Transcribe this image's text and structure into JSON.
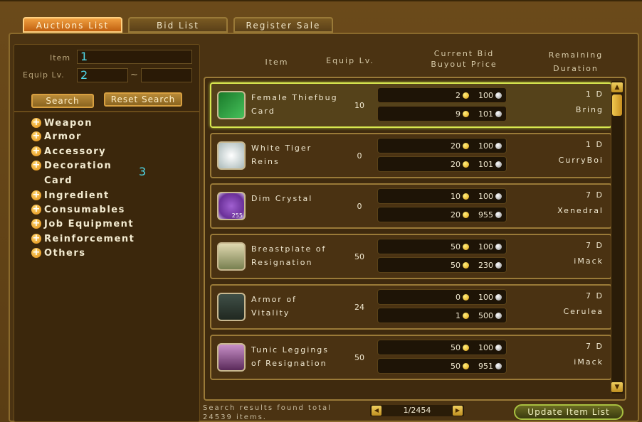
{
  "tabs": [
    {
      "label": "Auctions List",
      "active": true
    },
    {
      "label": "Bid List",
      "active": false
    },
    {
      "label": "Register Sale",
      "active": false
    }
  ],
  "search": {
    "item_label": "Item",
    "item_value": "1",
    "equip_label": "Equip Lv.",
    "equip_min": "2",
    "equip_sep": "~",
    "equip_max": "",
    "search_button": "Search",
    "reset_button": "Reset Search"
  },
  "categories": [
    {
      "label": "Weapon",
      "plus": "+"
    },
    {
      "label": "Armor",
      "plus": "+"
    },
    {
      "label": "Accessory",
      "plus": "+"
    },
    {
      "label": "Decoration",
      "plus": "+"
    },
    {
      "label": "Card"
    },
    {
      "label": "Ingredient",
      "plus": "+"
    },
    {
      "label": "Consumables",
      "plus": "+"
    },
    {
      "label": "Job Equipment",
      "plus": "+"
    },
    {
      "label": "Reinforcement",
      "plus": "+"
    },
    {
      "label": "Others",
      "plus": "+"
    }
  ],
  "category_marker": "3",
  "headers": {
    "item": "Item",
    "equip_lv": "Equip Lv.",
    "current_bid": "Current Bid",
    "buyout": "Buyout Price",
    "remaining": "Remaining",
    "duration": "Duration"
  },
  "items": [
    {
      "name_1": "Female Thiefbug",
      "name_2": "Card",
      "level": "10",
      "bid_gold": "2",
      "bid_silver": "100",
      "buy_gold": "9",
      "buy_silver": "101",
      "duration": "1 D",
      "seller": "Bring",
      "icon": "card-icon",
      "selected": true
    },
    {
      "name_1": "White Tiger",
      "name_2": "Reins",
      "level": "0",
      "bid_gold": "20",
      "bid_silver": "100",
      "buy_gold": "20",
      "buy_silver": "101",
      "duration": "1 D",
      "seller": "CurryBoi",
      "icon": "tiger-icon",
      "selected": false
    },
    {
      "name_1": "Dim Crystal",
      "name_2": "",
      "level": "0",
      "bid_gold": "10",
      "bid_silver": "100",
      "buy_gold": "20",
      "buy_silver": "955",
      "duration": "7 D",
      "seller": "Xenedral",
      "icon": "crystal-icon",
      "count": "255",
      "selected": false
    },
    {
      "name_1": "Breastplate of",
      "name_2": "Resignation",
      "level": "50",
      "bid_gold": "50",
      "bid_silver": "100",
      "buy_gold": "50",
      "buy_silver": "230",
      "duration": "7 D",
      "seller": "iMack",
      "icon": "breastplate-icon",
      "selected": false
    },
    {
      "name_1": "Armor of",
      "name_2": "Vitality",
      "level": "24",
      "bid_gold": "0",
      "bid_silver": "100",
      "buy_gold": "1",
      "buy_silver": "500",
      "duration": "7 D",
      "seller": "Cerulea",
      "icon": "armor-icon",
      "selected": false
    },
    {
      "name_1": "Tunic Leggings",
      "name_2": "of Resignation",
      "level": "50",
      "bid_gold": "50",
      "bid_silver": "100",
      "buy_gold": "50",
      "buy_silver": "951",
      "duration": "7 D",
      "seller": "iMack",
      "icon": "leggings-icon",
      "selected": false
    }
  ],
  "scroll": {
    "up": "▲",
    "down": "▼"
  },
  "footer": {
    "results_line_1": "Search results found total",
    "results_line_2": "24539 items.",
    "page": "1/2454",
    "prev": "◀",
    "next": "▶",
    "update_button": "Update Item List"
  }
}
